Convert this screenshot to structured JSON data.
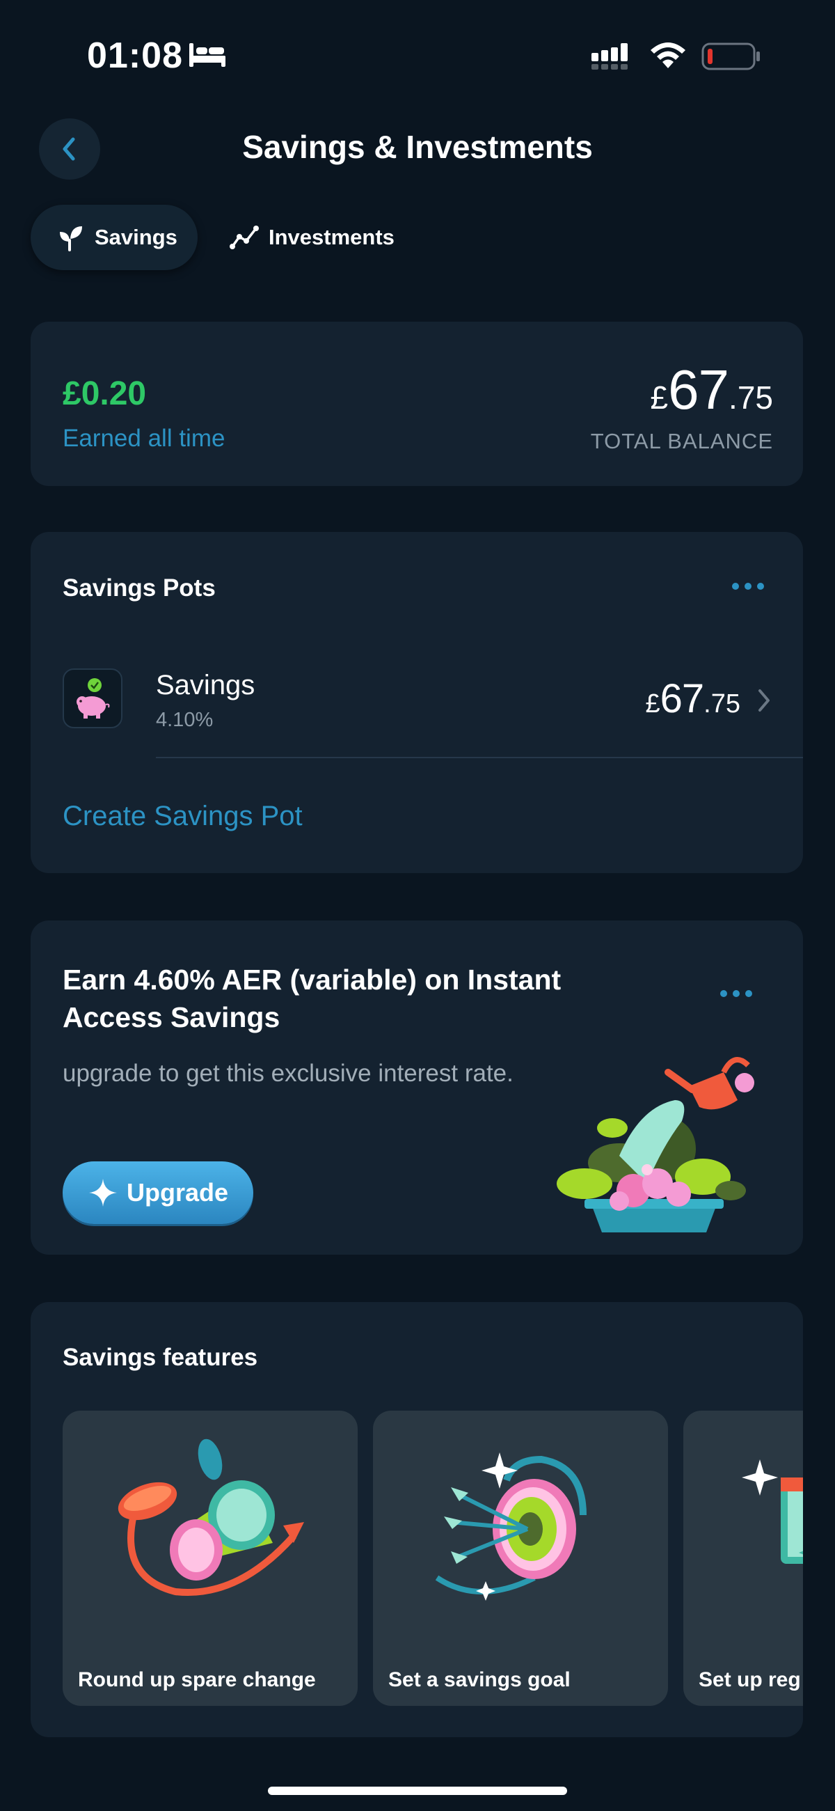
{
  "status_bar": {
    "time": "01:08"
  },
  "header": {
    "title": "Savings & Investments"
  },
  "tabs": [
    {
      "label": "Savings",
      "icon": "sprout-icon",
      "active": true
    },
    {
      "label": "Investments",
      "icon": "chart-line-icon",
      "active": false
    }
  ],
  "balance": {
    "earned_amount": "£0.20",
    "earned_label": "Earned all time",
    "currency": "£",
    "total_int": "67",
    "total_dec": ".75",
    "total_label": "TOTAL BALANCE"
  },
  "pots": {
    "title": "Savings Pots",
    "items": [
      {
        "name": "Savings",
        "rate": "4.10%",
        "currency": "£",
        "amount_int": "67",
        "amount_dec": ".75"
      }
    ],
    "create_label": "Create Savings Pot"
  },
  "promo": {
    "title": "Earn 4.60% AER (variable) on Instant Access Savings",
    "description": "upgrade to get this exclusive interest rate.",
    "button_label": "Upgrade"
  },
  "features": {
    "title": "Savings features",
    "items": [
      {
        "label": "Round up spare change"
      },
      {
        "label": "Set a savings goal"
      },
      {
        "label": "Set up reg"
      }
    ]
  },
  "colors": {
    "background": "#0a1520",
    "card": "#142230",
    "accent_blue": "#2c93c4",
    "positive_green": "#2ec866"
  }
}
